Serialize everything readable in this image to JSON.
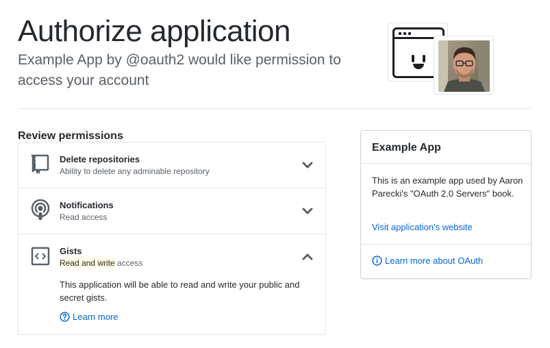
{
  "header": {
    "title": "Authorize application",
    "subtitle_app": "Example App",
    "subtitle_by": " by ",
    "subtitle_handle": "@oauth2",
    "subtitle_rest": " would like permission to access your account"
  },
  "illustration": {
    "app_icon": "smiley-window-icon",
    "avatar": "user-avatar-photo"
  },
  "permissions": {
    "heading": "Review permissions",
    "items": [
      {
        "name": "Delete repositories",
        "description": "Ability to delete any adminable repository",
        "icon": "repo-icon",
        "expanded": false
      },
      {
        "name": "Notifications",
        "description": "Read access",
        "icon": "broadcast-icon",
        "expanded": false
      },
      {
        "name": "Gists",
        "description_highlight": "Read and write",
        "description_rest": " access",
        "icon": "code-icon",
        "expanded": true,
        "detail": "This application will be able to read and write your public and secret gists.",
        "learn_more": "Learn more"
      }
    ]
  },
  "app_card": {
    "title": "Example App",
    "description": "This is an example app used by Aaron Parecki's \"OAuth 2.0 Servers\" book.",
    "website_link": "Visit application's website",
    "oauth_link": "Learn more about OAuth"
  },
  "colors": {
    "link": "#0366d6",
    "text": "#24292e",
    "muted": "#586069",
    "border": "#e1e4e8",
    "highlight": "#fffbdd"
  }
}
